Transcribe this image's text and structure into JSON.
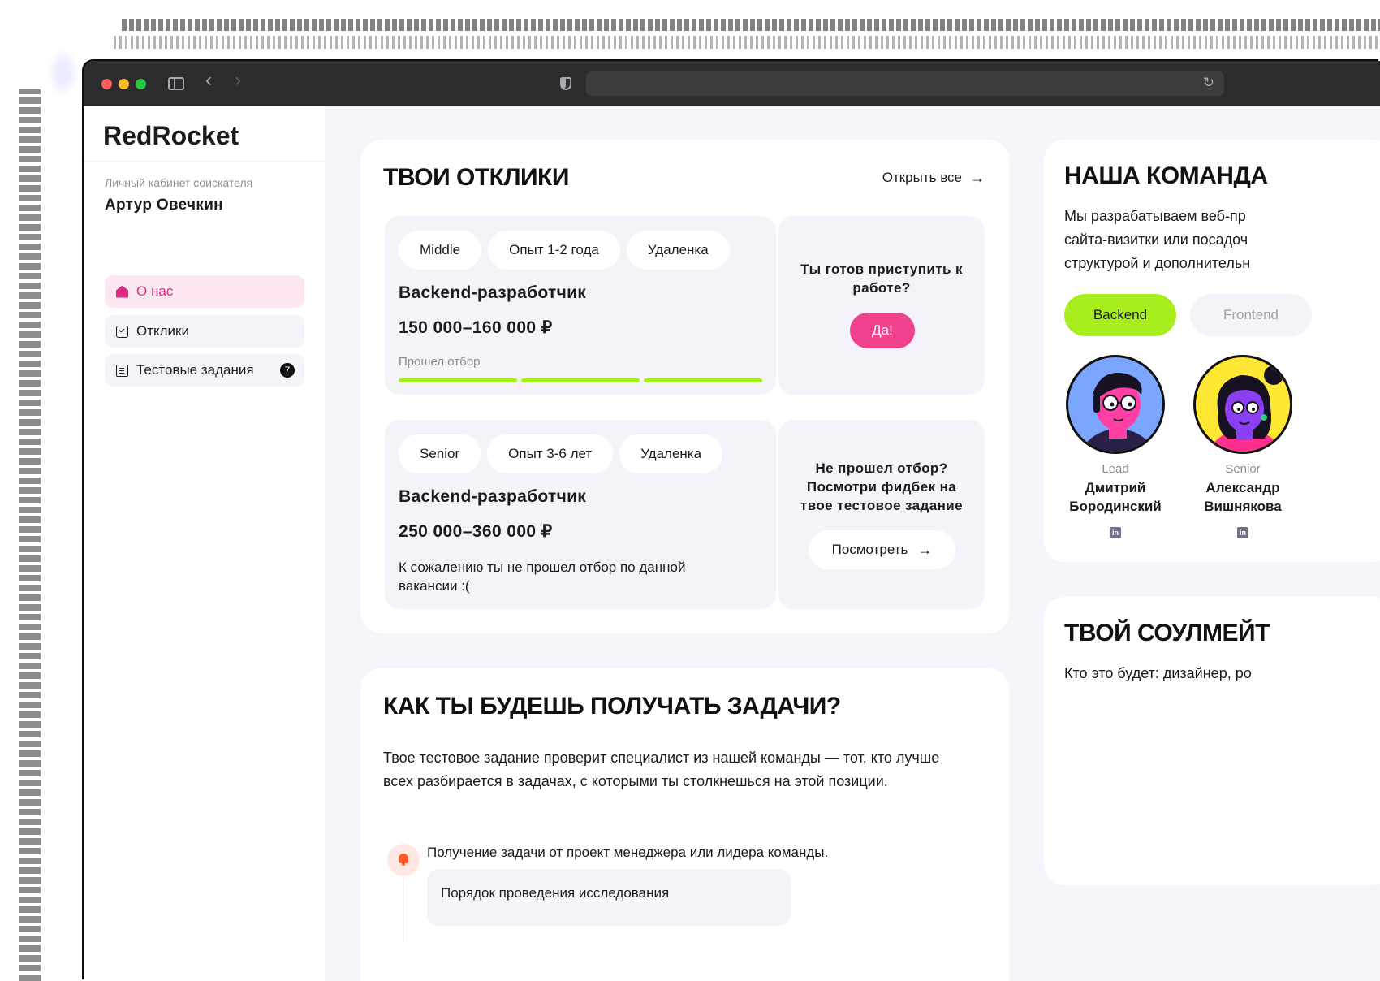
{
  "browser": {
    "url": ""
  },
  "sidebar": {
    "logo": "RedRocket",
    "caption": "Личный кабинет соискателя",
    "user": "Артур Овечкин",
    "items": [
      {
        "label": "О нас",
        "icon": "home-icon",
        "active": true
      },
      {
        "label": "Отклики",
        "icon": "checkbox-icon",
        "active": false
      },
      {
        "label": "Тестовые задания",
        "icon": "clipboard-icon",
        "active": false,
        "badge": "7"
      }
    ]
  },
  "responses": {
    "title": "ТВОИ ОТКЛИКИ",
    "open_all": "Открыть все",
    "vacancies": [
      {
        "chips": [
          "Middle",
          "Опыт 1-2 года",
          "Удаленка"
        ],
        "title": "Backend-разработчик",
        "salary": "150 000–160 000 ₽",
        "status": "Прошел отбор",
        "progress_done": 3,
        "progress_total": 3,
        "side_question": "Ты готов приступить к работе?",
        "side_button": "Да!"
      },
      {
        "chips": [
          "Senior",
          "Опыт 3-6 лет",
          "Удаленка"
        ],
        "title": "Backend-разработчик",
        "salary": "250 000–360 000 ₽",
        "note": "К сожалению ты не прошел отбор по данной вакансии :(",
        "side_question": "Не прошел отбор? Посмотри фидбек на твое тестовое задание",
        "side_button": "Посмотреть"
      }
    ]
  },
  "how": {
    "title": "КАК ТЫ БУДЕШЬ ПОЛУЧАТЬ ЗАДАЧИ?",
    "text": "Твое тестовое задание проверит специалист из нашей команды — тот, кто лучше всех разбирается в задачах, с которыми ты столкнешься на этой позиции.",
    "step": "Получение задачи от проект менеджера или лидера команды.",
    "sub_step": "Порядок проведения исследования"
  },
  "team": {
    "title": "НАША КОМАНДА",
    "text_lines": [
      "Мы разрабатываем веб-пр",
      "сайта-визитки или посадоч",
      "структурой и дополнительн"
    ],
    "tabs": [
      "Backend",
      "Frontend"
    ],
    "members": [
      {
        "role": "Lead",
        "name_line1": "Дмитрий",
        "name_line2": "Бородинский"
      },
      {
        "role": "Senior",
        "name_line1": "Александр",
        "name_line2": "Вишнякова"
      }
    ]
  },
  "soulmate": {
    "title": "ТВОЙ СОУЛМЕЙТ",
    "text": "Кто это будет: дизайнер, ро"
  },
  "colors": {
    "accent_pink": "#f0418e",
    "accent_green": "#a8ee1f",
    "page_bg": "#f6f5fc"
  }
}
